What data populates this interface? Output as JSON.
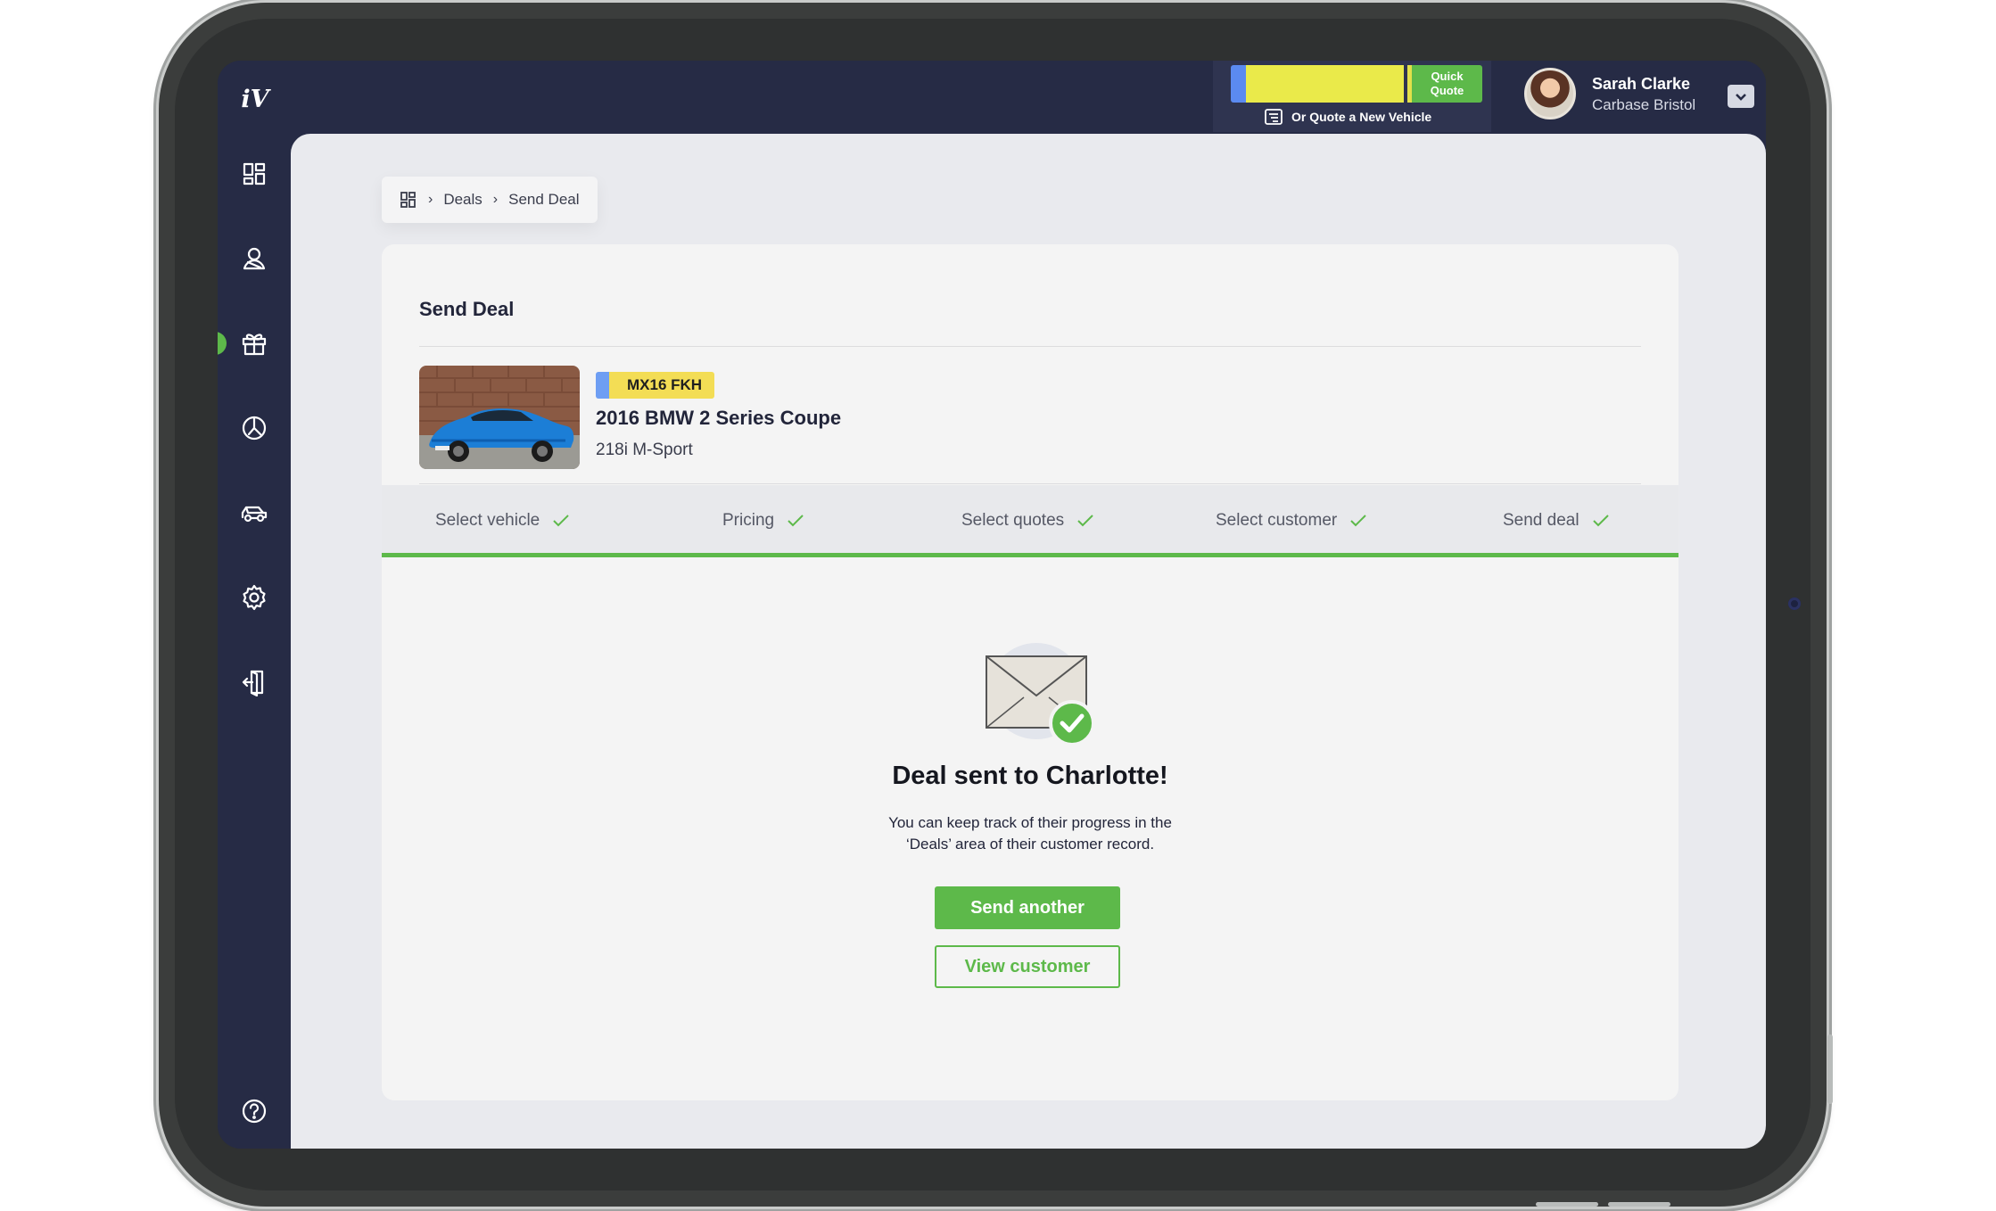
{
  "app": {
    "logo_text": "iV",
    "accent_color": "#5db94a",
    "nav_color": "#262b45"
  },
  "sidebar": {
    "items": [
      {
        "name": "dashboard",
        "icon": "dashboard-grid-icon"
      },
      {
        "name": "customers",
        "icon": "customers-icon"
      },
      {
        "name": "deals",
        "icon": "gift-icon",
        "active": true
      },
      {
        "name": "reports",
        "icon": "pie-chart-icon"
      },
      {
        "name": "vehicles",
        "icon": "car-icon"
      },
      {
        "name": "settings",
        "icon": "gear-icon"
      },
      {
        "name": "logout",
        "icon": "logout-icon"
      },
      {
        "name": "help",
        "icon": "help-icon"
      }
    ]
  },
  "topbar": {
    "quick_quote_value": "",
    "quick_quote_label": "Quick Quote",
    "new_vehicle_label": "Or Quote a New Vehicle",
    "user_name": "Sarah Clarke",
    "user_org": "Carbase Bristol"
  },
  "breadcrumb": {
    "items": [
      "Deals",
      "Send Deal"
    ]
  },
  "deal": {
    "title": "Send Deal",
    "registration": "MX16 FKH",
    "vehicle_title": "2016 BMW 2 Series Coupe",
    "vehicle_variant": "218i M-Sport"
  },
  "steps": [
    {
      "label": "Select vehicle",
      "complete": true
    },
    {
      "label": "Pricing",
      "complete": true
    },
    {
      "label": "Select quotes",
      "complete": true
    },
    {
      "label": "Select customer",
      "complete": true
    },
    {
      "label": "Send deal",
      "complete": true
    }
  ],
  "success": {
    "title": "Deal sent to Charlotte!",
    "line1": "You can keep track of their progress in the",
    "line2": "‘Deals’ area of their customer record.",
    "primary_button": "Send another",
    "secondary_button": "View customer"
  }
}
